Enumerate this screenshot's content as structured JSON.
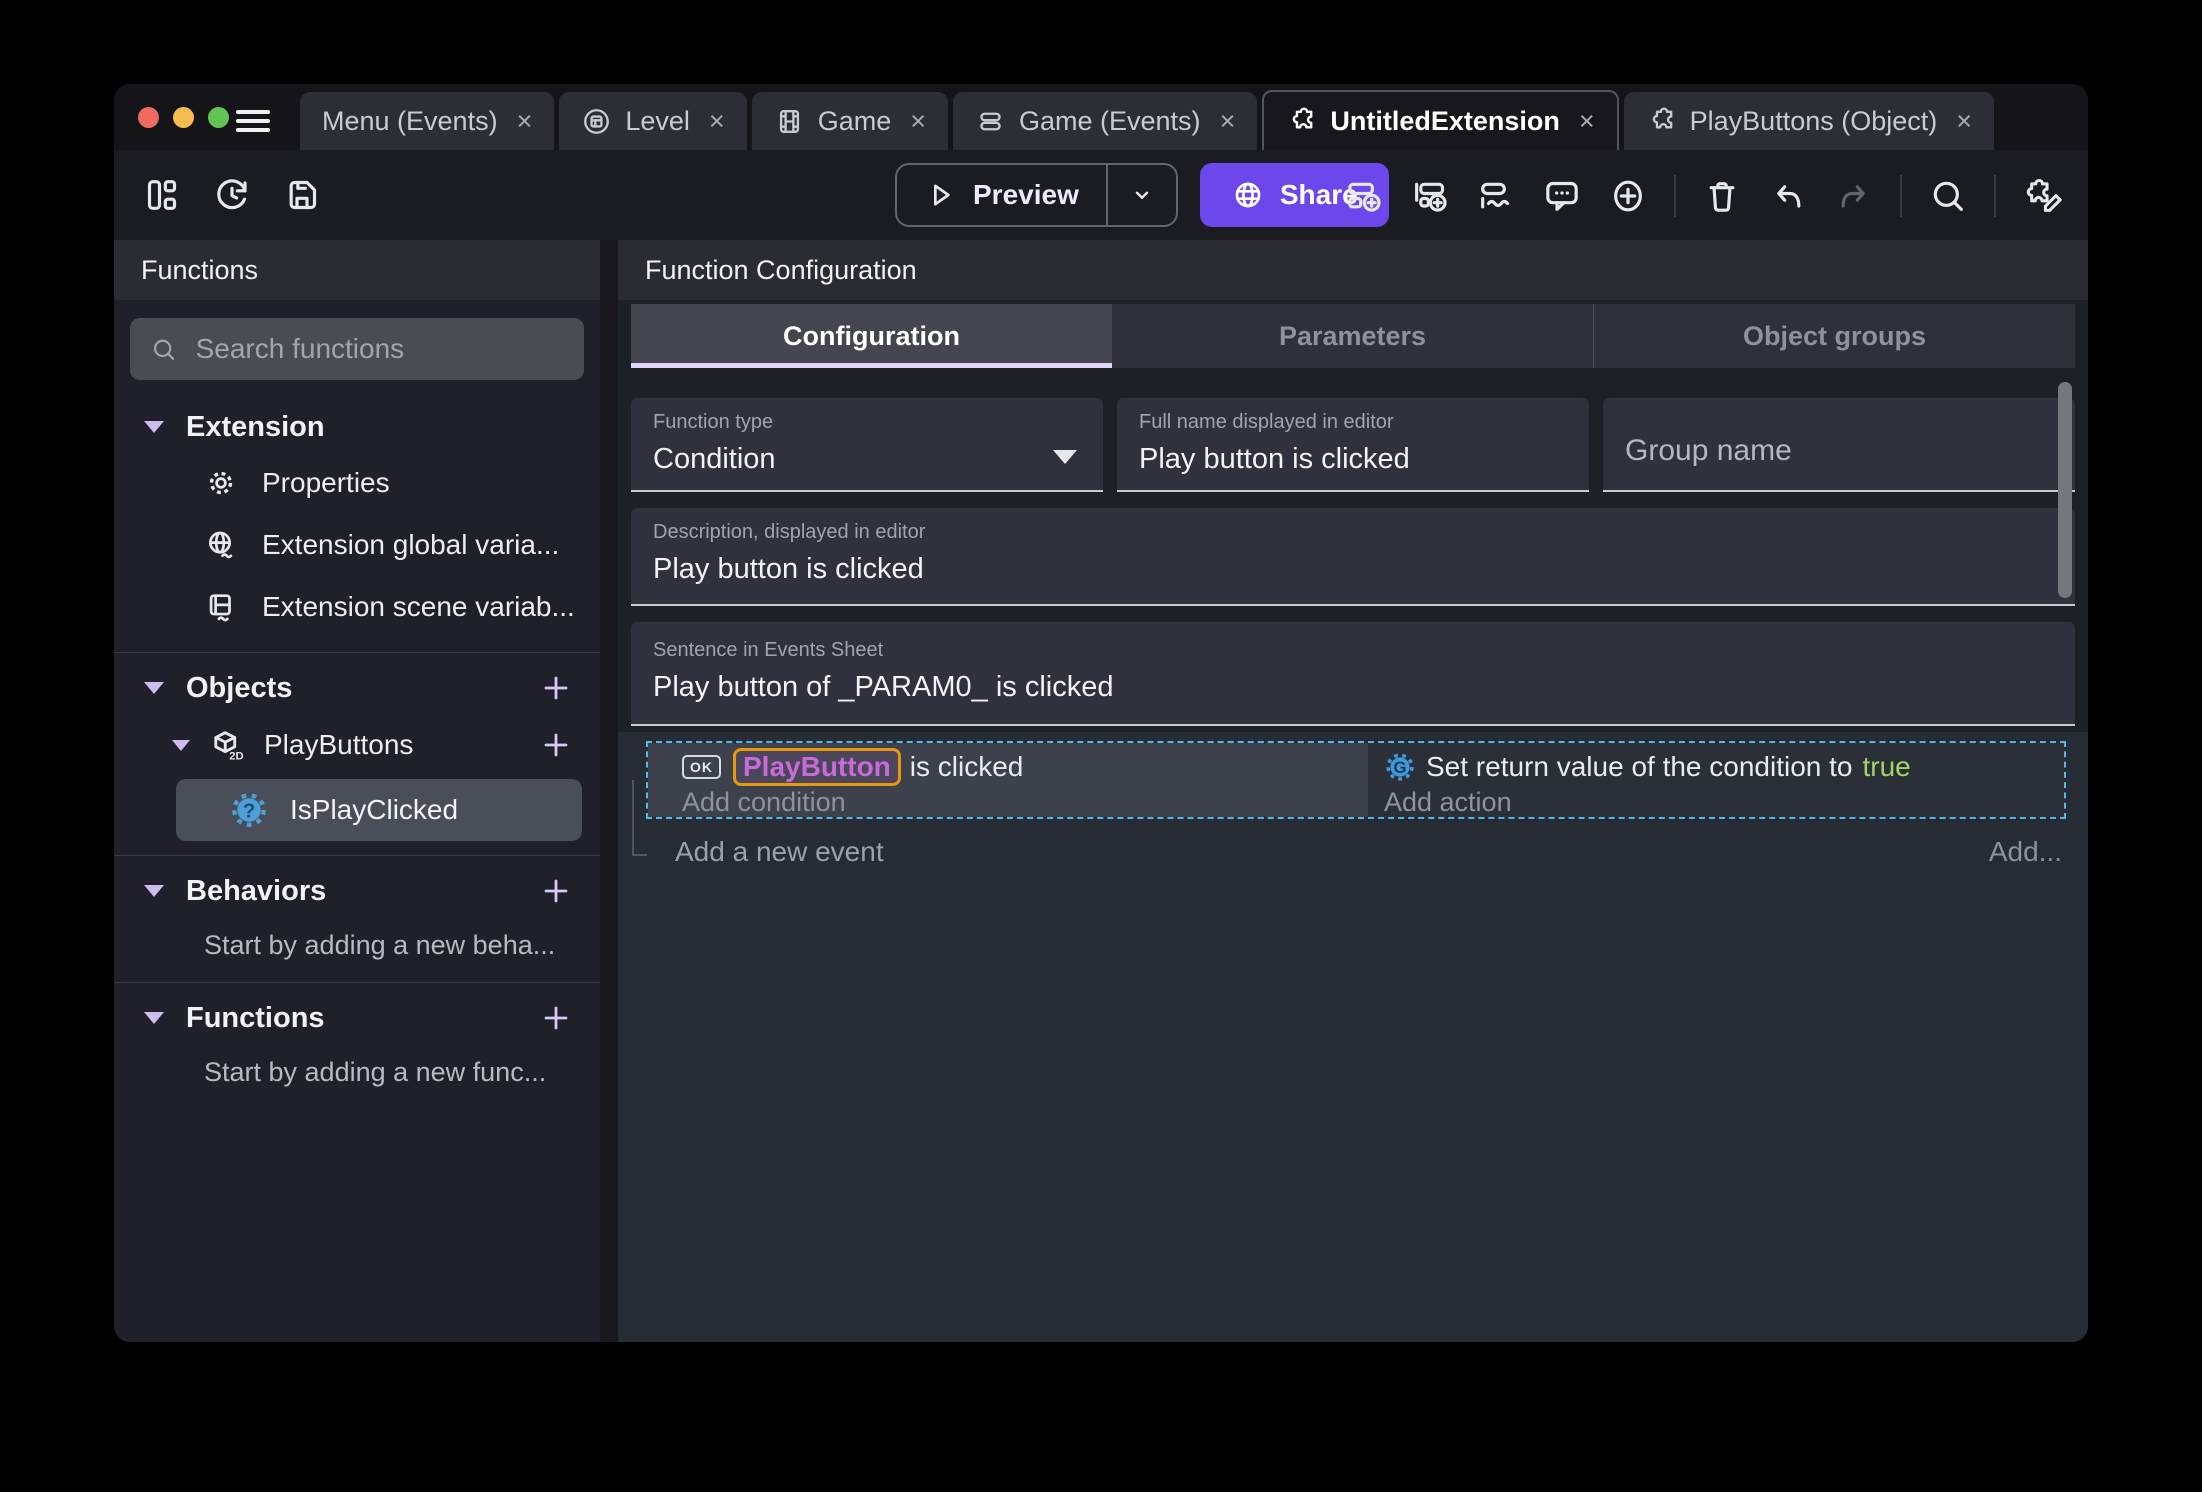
{
  "titlebar": {
    "close_glyph": "×",
    "tabs": [
      {
        "label": "Menu (Events)",
        "icon": "none"
      },
      {
        "label": "Level",
        "icon": "scene-icon"
      },
      {
        "label": "Game",
        "icon": "film-icon"
      },
      {
        "label": "Game (Events)",
        "icon": "events-sheet-icon"
      },
      {
        "label": "UntitledExtension",
        "icon": "puzzle-icon",
        "active": true
      },
      {
        "label": "PlayButtons (Object)",
        "icon": "puzzle-icon"
      }
    ]
  },
  "toolbar": {
    "preview_label": "Preview",
    "share_label": "Share",
    "icons": [
      "layout-icon",
      "history-icon",
      "save-icon",
      "add-event-icon",
      "add-subevent-icon",
      "add-other-event-icon",
      "comment-icon",
      "add-circle-icon",
      "trash-icon",
      "undo-icon",
      "redo-icon",
      "search-icon",
      "edit-extension-icon"
    ]
  },
  "sidebar": {
    "title": "Functions",
    "search": {
      "placeholder": "Search functions"
    },
    "extension": {
      "label": "Extension",
      "items": [
        {
          "label": "Properties",
          "icon": "gear-icon"
        },
        {
          "label": "Extension global varia...",
          "icon": "globe-variable-icon"
        },
        {
          "label": "Extension scene variab...",
          "icon": "scene-variable-icon"
        }
      ]
    },
    "objects": {
      "label": "Objects",
      "object_label": "PlayButtons",
      "object_type_badge": "2D",
      "function_label": "IsPlayClicked"
    },
    "behaviors": {
      "label": "Behaviors",
      "empty": "Start by adding a new beha..."
    },
    "functions": {
      "label": "Functions",
      "empty": "Start by adding a new func..."
    }
  },
  "main": {
    "header": "Function Configuration",
    "tabs": [
      {
        "label": "Configuration",
        "active": true
      },
      {
        "label": "Parameters"
      },
      {
        "label": "Object groups"
      }
    ],
    "fields": {
      "function_type": {
        "label": "Function type",
        "value": "Condition"
      },
      "full_name": {
        "label": "Full name displayed in editor",
        "value": "Play button is clicked"
      },
      "group_name": {
        "placeholder": "Group name"
      },
      "description": {
        "label": "Description, displayed in editor",
        "value": "Play button is clicked"
      },
      "sentence": {
        "label": "Sentence in Events Sheet",
        "value": "Play button of _PARAM0_ is clicked"
      }
    },
    "events": {
      "condition": {
        "object_badge": "OK",
        "object_name": "PlayButton",
        "suffix": "is clicked",
        "add_label": "Add condition"
      },
      "action": {
        "prefix": "Set return value of the condition to",
        "value": "true",
        "add_label": "Add action"
      },
      "add_event_label": "Add a new event",
      "add_more_label": "Add..."
    }
  },
  "colors": {
    "accent_purple": "#6C47EB",
    "accent_lavender": "#DFD4F9",
    "chip_border_orange": "#E8980C",
    "chip_text_purple": "#C76BD8",
    "true_green": "#A3D366",
    "selection_dashed_blue": "#4FB8E8",
    "traffic_red": "#EE6A5F",
    "traffic_yellow": "#F5BD4F",
    "traffic_green": "#61C554"
  }
}
